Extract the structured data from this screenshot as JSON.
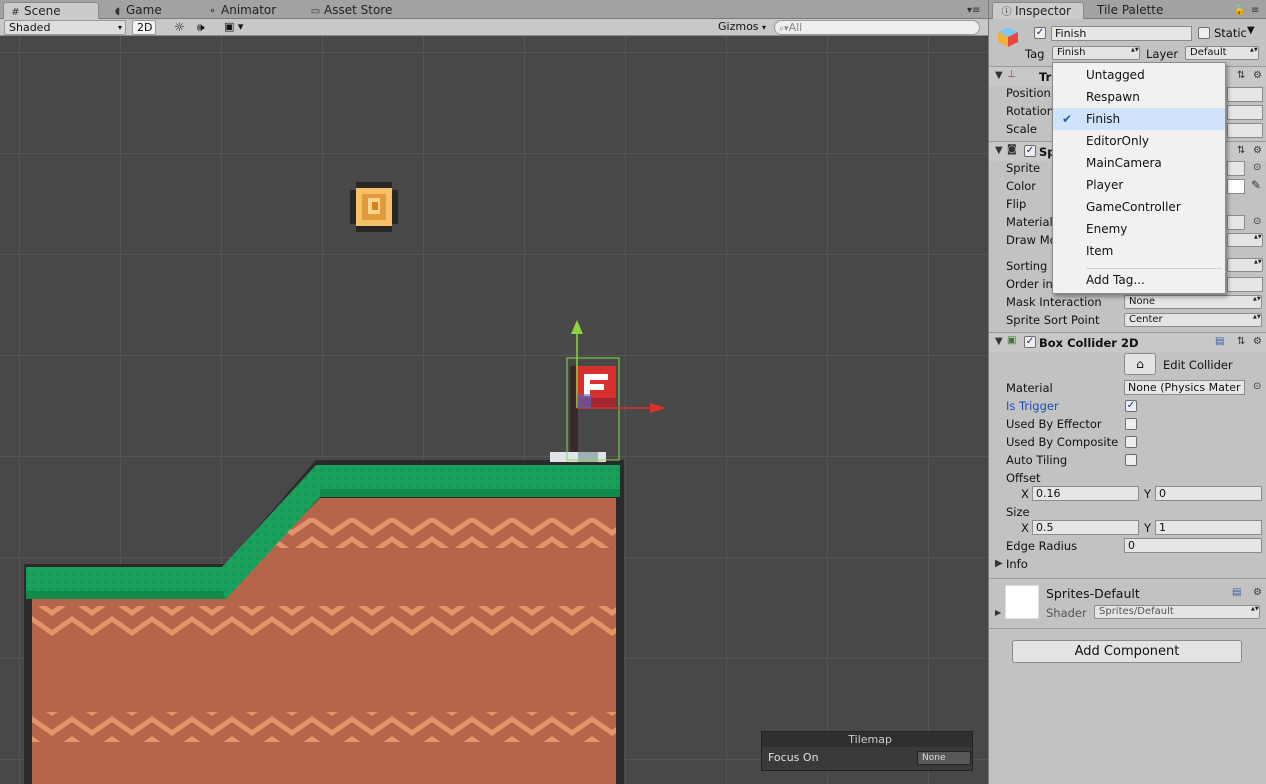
{
  "scene_tabs": [
    {
      "label": "Scene",
      "icon": "hash-icon",
      "active": true
    },
    {
      "label": "Game",
      "icon": "pacman-icon",
      "active": false
    },
    {
      "label": "Animator",
      "icon": "animator-icon",
      "active": false
    },
    {
      "label": "Asset Store",
      "icon": "store-icon",
      "active": false
    }
  ],
  "scene_toolbar": {
    "shading_mode": "Shaded",
    "mode_2d": "2D",
    "gizmos_label": "Gizmos",
    "search_placeholder": "All"
  },
  "tilemap_overlay": {
    "title": "Tilemap",
    "focus_label": "Focus On",
    "focus_value": "None"
  },
  "inspector_tabs": [
    {
      "label": "Inspector",
      "icon": "info-icon",
      "active": true
    },
    {
      "label": "Tile Palette",
      "icon": "",
      "active": false
    }
  ],
  "object_header": {
    "name": "Finish",
    "active": true,
    "static_label": "Static",
    "static_checked": false,
    "tag_label": "Tag",
    "tag_value": "Finish",
    "layer_label": "Layer",
    "layer_value": "Default"
  },
  "transform": {
    "title": "Tr",
    "rows": [
      "Position",
      "Rotation",
      "Scale"
    ]
  },
  "sprite_renderer": {
    "title": "Spr",
    "rows": [
      "Sprite",
      "Color",
      "Flip",
      "Material",
      "Draw Mo",
      "Sorting",
      "Order in",
      "Mask Interaction",
      "Sprite Sort Point"
    ],
    "mask_interaction_value": "None",
    "sprite_sort_point_value": "Center"
  },
  "box_collider": {
    "title": "Box Collider 2D",
    "enabled": true,
    "edit_collider_label": "Edit Collider",
    "material_label": "Material",
    "material_value": "None (Physics Mater",
    "is_trigger_label": "Is Trigger",
    "is_trigger": true,
    "used_by_effector_label": "Used By Effector",
    "used_by_composite_label": "Used By Composite",
    "auto_tiling_label": "Auto Tiling",
    "offset_label": "Offset",
    "offset_x_label": "X",
    "offset_x": "0.16",
    "offset_y_label": "Y",
    "offset_y": "0",
    "size_label": "Size",
    "size_x_label": "X",
    "size_x": "0.5",
    "size_y_label": "Y",
    "size_y": "1",
    "edge_radius_label": "Edge Radius",
    "edge_radius": "0",
    "info_label": "Info"
  },
  "material_section": {
    "name": "Sprites-Default",
    "shader_label": "Shader",
    "shader_value": "Sprites/Default"
  },
  "add_component_label": "Add Component",
  "tag_menu": {
    "items": [
      "Untagged",
      "Respawn",
      "Finish",
      "EditorOnly",
      "MainCamera",
      "Player",
      "GameController",
      "Enemy",
      "Item"
    ],
    "selected": "Finish",
    "add_tag_label": "Add Tag..."
  },
  "colors": {
    "scene_bg": "#484848",
    "grass": "#1aa05b",
    "dirt": "#b9674a",
    "dirt_stripe": "#e49468",
    "flag_red": "#d8302f",
    "selection_blue": "#cfe4fb",
    "trigger_label": "#1a4fb5"
  }
}
